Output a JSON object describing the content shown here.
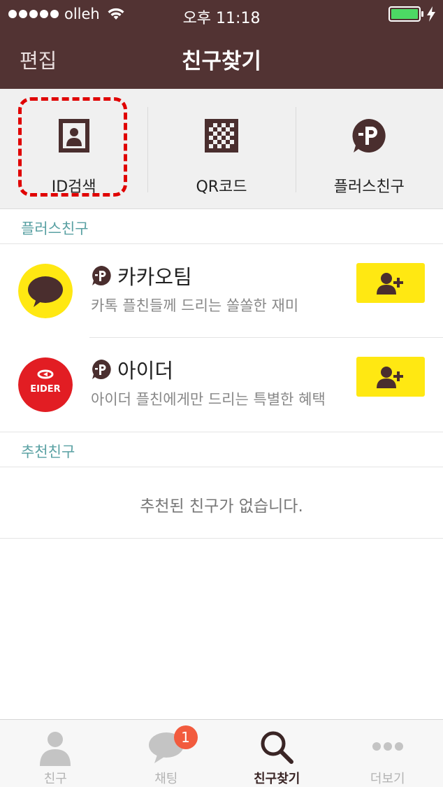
{
  "status_bar": {
    "carrier": "olleh",
    "time": "오후 11:18"
  },
  "nav": {
    "edit_label": "편집",
    "title": "친구찾기"
  },
  "search_options": [
    {
      "label": "ID검색",
      "icon": "id-card-icon",
      "highlighted": true
    },
    {
      "label": "QR코드",
      "icon": "qr-code-icon",
      "highlighted": false
    },
    {
      "label": "플러스친구",
      "icon": "plus-friend-icon",
      "highlighted": false
    }
  ],
  "plus_friends": {
    "section_title": "플러스친구",
    "items": [
      {
        "name": "카카오팀",
        "description": "카톡 플친들께 드리는 쏠쏠한 재미",
        "avatar": "kakao-logo"
      },
      {
        "name": "아이더",
        "description": "아이더 플친에게만 드리는 특별한 혜택",
        "avatar": "eider-logo",
        "logo_text": "EIDER"
      }
    ]
  },
  "recommended": {
    "section_title": "추천친구",
    "empty_text": "추천된 친구가 없습니다."
  },
  "tabs": [
    {
      "label": "친구",
      "icon": "person-icon",
      "active": false
    },
    {
      "label": "채팅",
      "icon": "chat-bubble-icon",
      "active": false,
      "badge": "1"
    },
    {
      "label": "친구찾기",
      "icon": "search-icon",
      "active": true
    },
    {
      "label": "더보기",
      "icon": "more-icon",
      "active": false
    }
  ],
  "colors": {
    "header": "#523333",
    "accent_yellow": "#ffe812",
    "section_title": "#5aa1a3",
    "badge": "#f25b3e",
    "highlight": "#e00000"
  }
}
